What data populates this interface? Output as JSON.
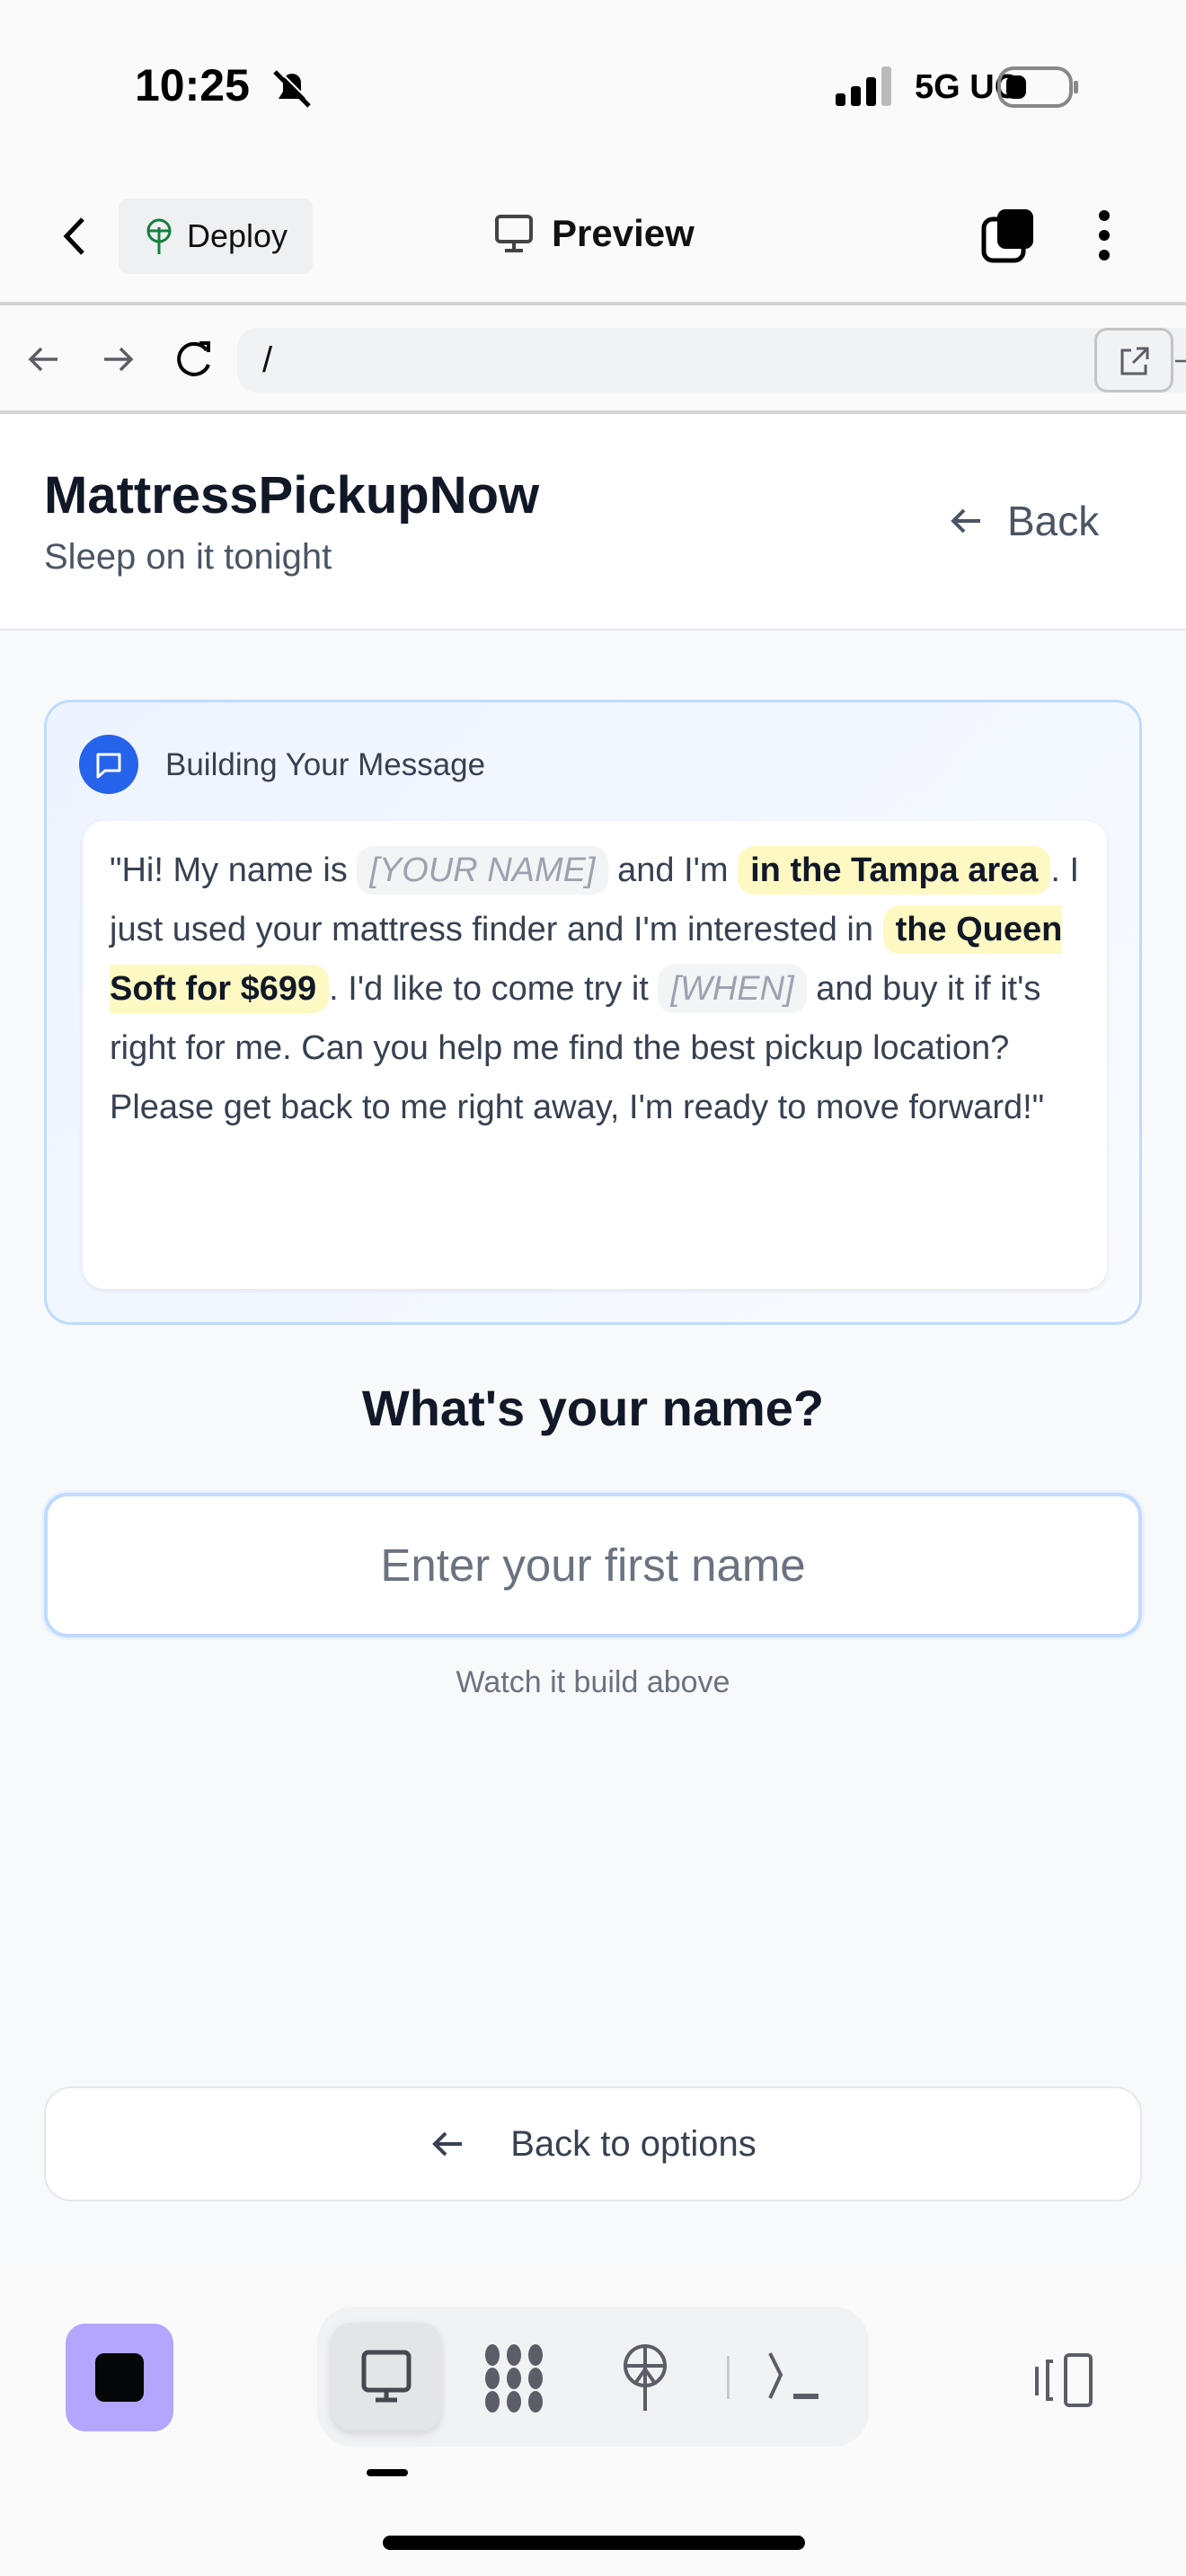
{
  "status_bar": {
    "time": "10:25",
    "network": "5G UC"
  },
  "nav": {
    "deploy_label": "Deploy",
    "title": "Preview"
  },
  "url_bar": {
    "value": "/"
  },
  "app": {
    "title": "MattressPickupNow",
    "subtitle": "Sleep on it tonight",
    "back_label": "Back"
  },
  "message_card": {
    "header": "Building Your Message",
    "parts": {
      "p1": "\"Hi! My name is ",
      "name": "[YOUR NAME]",
      "p2": " and I'm ",
      "area": "in the Tampa area",
      "p3": ". I just used your mattress finder and I'm interested in ",
      "product": "the Queen Soft for $699",
      "p4": ". I'd like to come try it ",
      "when": "[WHEN]",
      "p5": " and buy it if it's right for me. Can you help me find the best pickup location? Please get back to me right away, I'm ready to move forward!\""
    }
  },
  "form": {
    "question": "What's your name?",
    "placeholder": "Enter your first name",
    "hint": "Watch it build above"
  },
  "back_to_options": "Back to options",
  "colors": {
    "accent": "#2563eb",
    "highlight": "#fef9c3",
    "app_icon": "#b4a5ff"
  }
}
